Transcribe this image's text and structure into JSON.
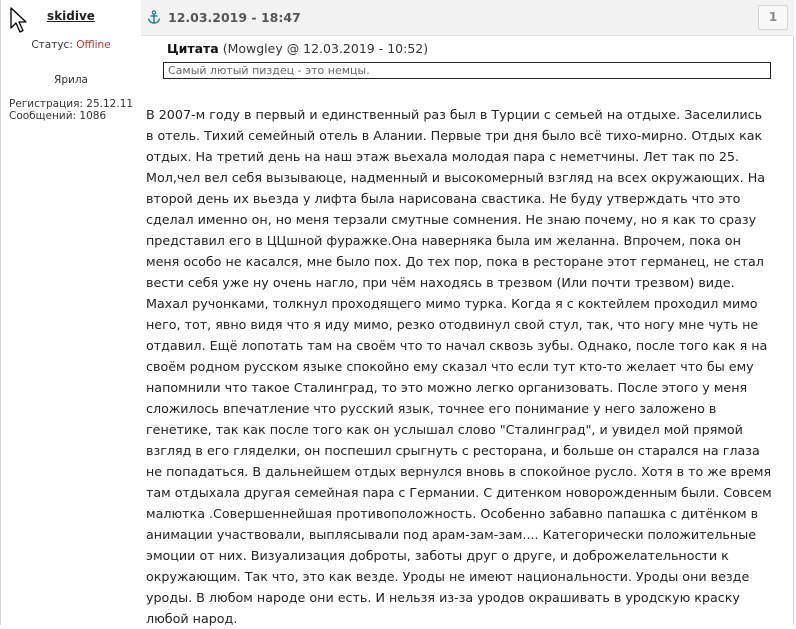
{
  "user": {
    "name": "skidive",
    "status_label": "Статус:",
    "status_value": "Offline",
    "title": "Ярила",
    "reg_label": "Регистрация:",
    "reg_date": "25.12.11",
    "posts_label": "Сообщений:",
    "posts_count": "1086"
  },
  "post": {
    "datetime": "12.03.2019 - 18:47",
    "number": "1"
  },
  "quote": {
    "label": "Цитата",
    "meta": "(Mowgley @ 12.03.2019 - 10:52)",
    "text": "Самый лютый пиздец - это немцы."
  },
  "message_lines": [
    "В 2007-м году в первый и единственный раз был в Турции с семьей на отдыхе. Заселились",
    "в отель. Тихий семейный отель в Алании. Первые три дня было всё тихо-мирно. Отдых как",
    "отдых. На третий день на наш этаж вьехала молодая пара с неметчины. Лет так по 25.",
    "Мол,чел вел себя вызываюце, надменный и высокомерный взгляд на всех окружающих. На",
    "второй день их вьезда у лифта была нарисована свастика. Не буду утверждать что это",
    "сделал именно он, но меня терзали смутные сомнения. Не знаю почему, но я как то сразу",
    "представил его в ЦЦшной фуражке.Она наверняка была им желанна. Впрочем, пока он",
    "меня особо не касался, мне было пох. До тех пор, пока в ресторане этот германец, не стал",
    "вести себя уже ну очень нагло, при чём находясь в трезвом (Или почти трезвом) виде.",
    "Махал ручонками, толкнул проходящего мимо турка. Когда я с коктейлем проходил мимо",
    "него, тот, явно видя что я иду мимо, резко отодвинул свой стул, так, что ногу мне чуть не",
    "отдавил. Ещё лопотать там на своём что то начал сквозь зубы. Однако, после того как я на",
    "своём родном русском языке спокойно ему сказал что если тут кто-то желает что бы ему",
    "напомнили что такое Сталинград, то это можно легко организовать. После этого у меня",
    "сложилось впечатление что русский язык, точнее его понимание у него заложено в",
    "генетике, так как после того как он услышал слово \"Сталинград\", и увидел мой прямой",
    "взгляд в его гляделки, он поспешил срыгнуть с ресторана, и больше он старался на глаза",
    "не попадаться. В дальнейшем отдых вернулся вновь в спокойное русло. Хотя в то же время",
    "там отдыхала другая семейная пара с Германии. С дитенком новорожденным были. Совсем",
    "малютка .Совершеннейшая противоположность. Особенно забавно папашка с дитёнком в",
    "анимации участвовали, выплясывали под арам-зам-зам.... Категорически положительные",
    "эмоции от них. Визуализация доброты, заботы друг о друге, и доброжелательности к",
    "окружающим. Так что, это как везде. Уроды не имеют национальности. Уроды они везде",
    "уроды. В любом народе они есть. И нельзя из-за уродов окрашивать в уродскую краску",
    "любой народ."
  ],
  "icons": {
    "cursor": "mouse-pointer-icon",
    "anchor": "anchor-icon"
  },
  "colors": {
    "status_offline": "#c0392b",
    "header_bg": "#f2f2f2",
    "anchor": "#1f7a8c"
  }
}
